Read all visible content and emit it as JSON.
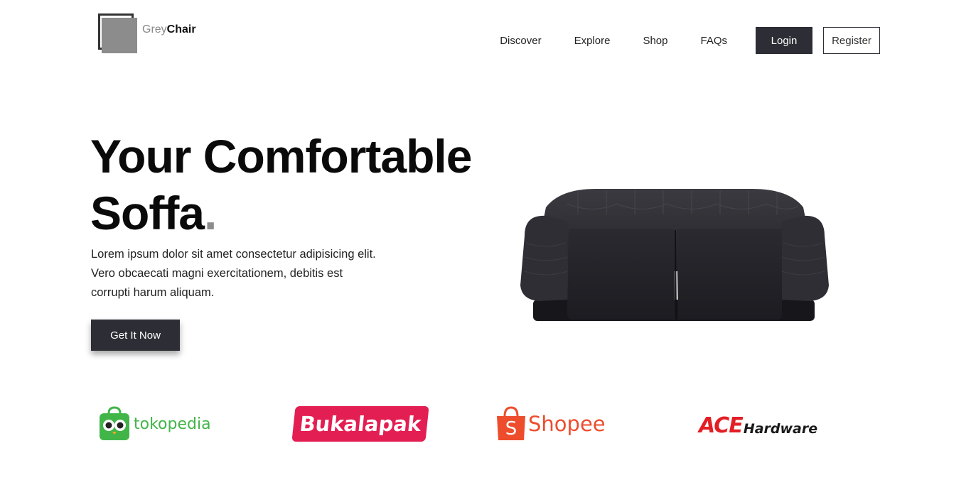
{
  "header": {
    "logo": {
      "grey": "Grey",
      "chair": "Chair"
    },
    "nav": [
      {
        "label": "Discover"
      },
      {
        "label": "Explore"
      },
      {
        "label": "Shop"
      },
      {
        "label": "FAQs"
      }
    ],
    "login_label": "Login",
    "register_label": "Register"
  },
  "hero": {
    "title_line1": "Your Comfortable",
    "title_line2": "Soffa",
    "title_dot": ".",
    "description_lines": [
      "Lorem ipsum dolor sit amet consectetur adipisicing elit.",
      "Vero obcaecati magni exercitationem, debitis est",
      "corrupti harum aliquam."
    ],
    "cta_label": "Get It Now",
    "image": "black-sofa-image"
  },
  "partners": [
    {
      "name": "tokopedia",
      "icon": "tokopedia-owl-bag-icon",
      "color": "#42b549"
    },
    {
      "name": "Bukalapak",
      "color": "#e31e52"
    },
    {
      "name": "Shopee",
      "icon": "shopee-bag-icon",
      "color": "#ee4d2d"
    },
    {
      "name_ace": "ACE",
      "name_hardware": "Hardware",
      "color": "#e31e24"
    }
  ],
  "colors": {
    "primary_dark": "#2d2d35",
    "accent_grey": "#8c8c8c"
  }
}
